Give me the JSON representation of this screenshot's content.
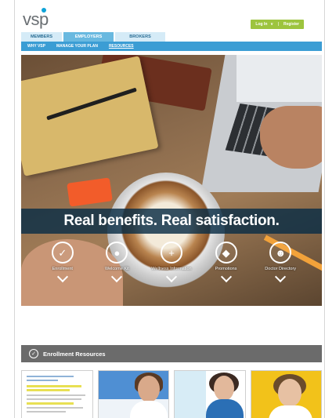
{
  "header": {
    "logo": "vsp",
    "login": {
      "label": "Log In",
      "caret": "v",
      "separator": "|",
      "register": "Register"
    }
  },
  "tabs": [
    {
      "label": "MEMBERS",
      "active": false
    },
    {
      "label": "EMPLOYERS",
      "active": true
    },
    {
      "label": "BROKERS",
      "active": false
    }
  ],
  "subnav": [
    {
      "label": "WHY VSP",
      "current": false
    },
    {
      "label": "MANAGE YOUR PLAN",
      "current": false
    },
    {
      "label": "RESOURCES",
      "current": true
    }
  ],
  "hero": {
    "headline": "Real benefits. Real satisfaction.",
    "items": [
      {
        "label": "Enrollment",
        "icon": "check-icon",
        "glyph": "✓"
      },
      {
        "label": "Welcome Kit",
        "icon": "speech-bubble-icon",
        "glyph": "●"
      },
      {
        "label": "Wellness Information",
        "icon": "plus-icon",
        "glyph": "+"
      },
      {
        "label": "Promotions",
        "icon": "tag-icon",
        "glyph": "◆"
      },
      {
        "label": "Doctor Directory",
        "icon": "people-icon",
        "glyph": "☻"
      }
    ]
  },
  "resources": {
    "title": "Enrollment Resources",
    "thumbnails": [
      "document-thumbnail",
      "doctor-flyer-thumbnail",
      "vision-care-flyer-thumbnail",
      "eyewear-flyer-thumbnail"
    ]
  },
  "colors": {
    "brand_blue": "#3b9dd4",
    "tab_active": "#69b9e0",
    "login_green": "#9dc43e",
    "banner": "#0a2d46",
    "resource_bar": "#6b6b6b"
  }
}
